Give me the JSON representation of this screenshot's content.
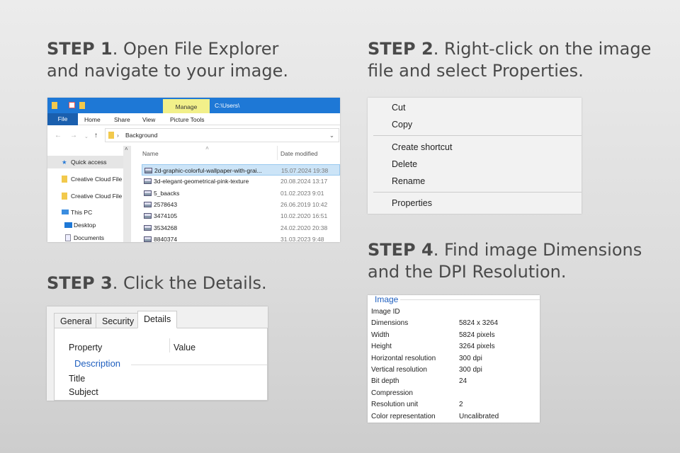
{
  "steps": [
    {
      "num": "STEP 1",
      "text": ". Open File Explorer",
      "text2": "and navigate to your image."
    },
    {
      "num": "STEP 2",
      "text": ". Right-click on the image",
      "text2": "file and select Properties."
    },
    {
      "num": "STEP 3",
      "text": ". Click the Details."
    },
    {
      "num": "STEP 4",
      "text": ". Find image Dimensions",
      "text2": "and the DPI Resolution."
    }
  ],
  "explorer": {
    "manage": "Manage",
    "path": "C:\\Users\\",
    "ribbon": [
      "File",
      "Home",
      "Share",
      "View",
      "Picture Tools"
    ],
    "address": "Background",
    "sidebar": [
      "Quick access",
      "Creative Cloud File",
      "Creative Cloud File",
      "This PC",
      "Desktop",
      "Documents"
    ],
    "col_name": "Name",
    "col_date": "Date modified",
    "files": [
      {
        "name": "2d-graphic-colorful-wallpaper-with-grai...",
        "date": "15.07.2024 19:38"
      },
      {
        "name": "3d-elegant-geometrical-pink-texture",
        "date": "20.08.2024 13:17"
      },
      {
        "name": "5_baacks",
        "date": "01.02.2023 9:01"
      },
      {
        "name": "2578643",
        "date": "26.06.2019 10:42"
      },
      {
        "name": "3474105",
        "date": "10.02.2020 16:51"
      },
      {
        "name": "3534268",
        "date": "24.02.2020 20:38"
      },
      {
        "name": "8840374",
        "date": "31.03.2023 9:48"
      }
    ]
  },
  "context_menu": [
    "Cut",
    "Copy",
    "Create shortcut",
    "Delete",
    "Rename",
    "Properties"
  ],
  "details": {
    "tabs": [
      "General",
      "Security",
      "Details"
    ],
    "col_property": "Property",
    "col_value": "Value",
    "section": "Description",
    "rows": [
      "Title",
      "Subject"
    ]
  },
  "image_props": {
    "section": "Image",
    "rows": [
      {
        "k": "Image ID",
        "v": ""
      },
      {
        "k": "Dimensions",
        "v": "5824 x 3264"
      },
      {
        "k": "Width",
        "v": "5824 pixels"
      },
      {
        "k": "Height",
        "v": "3264 pixels"
      },
      {
        "k": "Horizontal resolution",
        "v": "300 dpi"
      },
      {
        "k": "Vertical resolution",
        "v": "300 dpi"
      },
      {
        "k": "Bit depth",
        "v": "24"
      },
      {
        "k": "Compression",
        "v": ""
      },
      {
        "k": "Resolution unit",
        "v": "2"
      },
      {
        "k": "Color representation",
        "v": "Uncalibrated"
      }
    ]
  }
}
